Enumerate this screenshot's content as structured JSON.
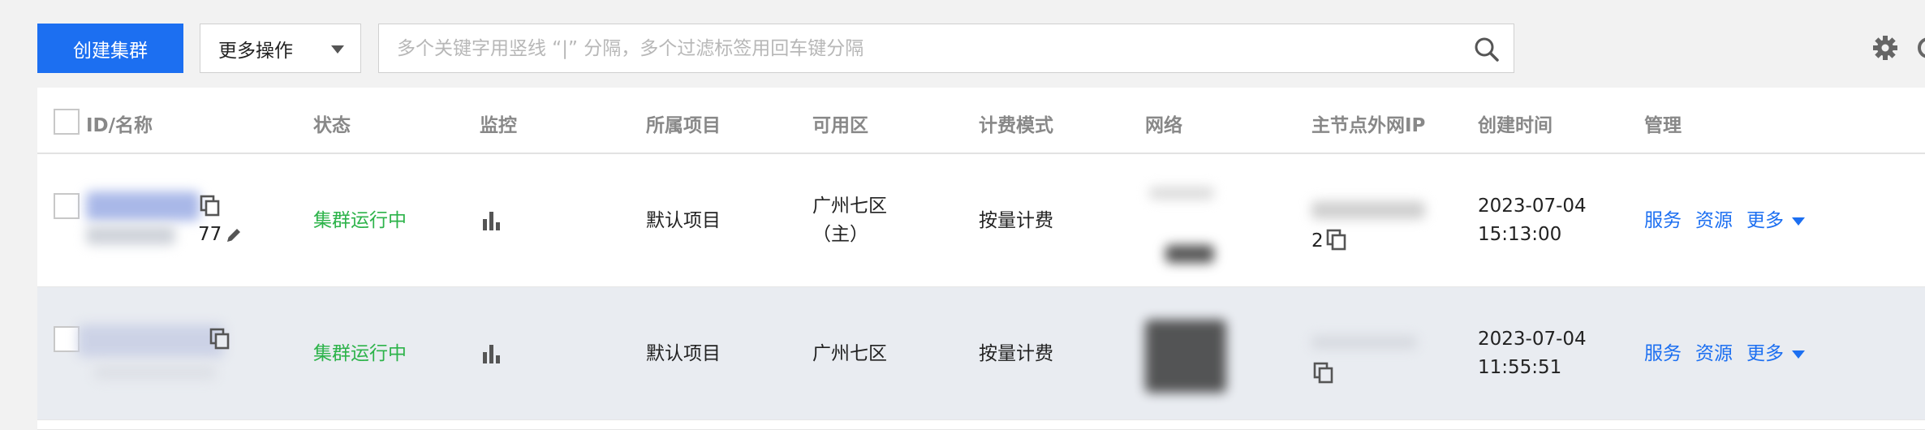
{
  "toolbar": {
    "create_label": "创建集群",
    "more_ops_label": "更多操作",
    "search_placeholder": "多个关键字用竖线 “|” 分隔，多个过滤标签用回车键分隔"
  },
  "table": {
    "columns": [
      "ID/名称",
      "状态",
      "监控",
      "所属项目",
      "可用区",
      "计费模式",
      "网络",
      "主节点外网IP",
      "创建时间",
      "管理"
    ],
    "rows": [
      {
        "id_suffix": "77",
        "status": "集群运行中",
        "project": "默认项目",
        "zone_line1": "广州七区",
        "zone_line2": "（主）",
        "billing": "按量计费",
        "ip_suffix": "2",
        "created_date": "2023-07-04",
        "created_time": "15:13:00",
        "actions": {
          "service": "服务",
          "resource": "资源",
          "more": "更多"
        }
      },
      {
        "status": "集群运行中",
        "project": "默认项目",
        "zone_line1": "广州七区",
        "billing": "按量计费",
        "created_date": "2023-07-04",
        "created_time": "11:55:51",
        "actions": {
          "service": "服务",
          "resource": "资源",
          "more": "更多"
        }
      }
    ]
  },
  "colors": {
    "primary": "#1c6ff1",
    "status_running": "#2db34a",
    "header_text": "#888888"
  },
  "icons": [
    "search-icon",
    "settings-gear-icon",
    "copy-icon",
    "edit-pencil-icon",
    "monitor-bar-chart-icon",
    "caret-down-icon"
  ]
}
